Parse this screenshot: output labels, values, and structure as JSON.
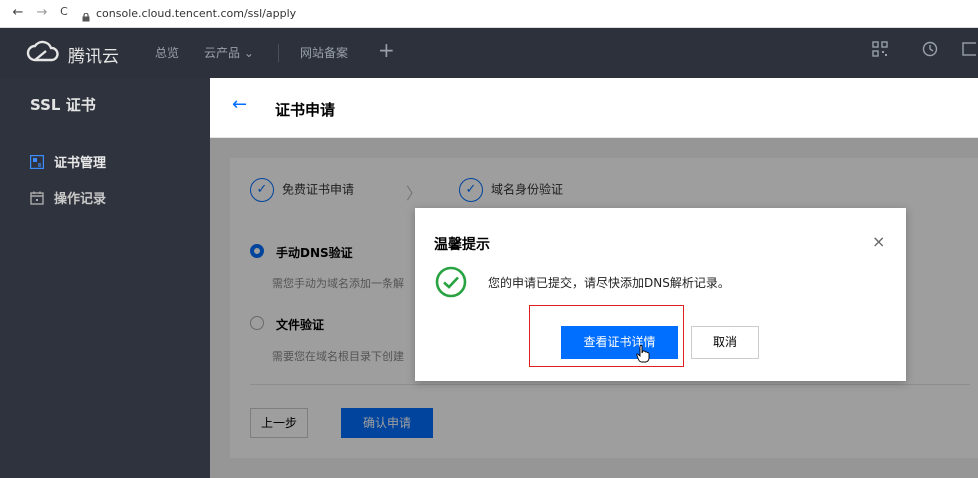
{
  "browser": {
    "back": "←",
    "forward": "→",
    "reload": "C",
    "url": "console.cloud.tencent.com/ssl/apply"
  },
  "topnav": {
    "brand": "腾讯云",
    "items": [
      "总览",
      "云产品 ⌄",
      "网站备案"
    ],
    "plus": "+",
    "right_icons": [
      "qrcode-icon",
      "clock-icon",
      "message-icon"
    ]
  },
  "sidebar": {
    "title": "SSL 证书",
    "items": [
      {
        "label": "证书管理",
        "icon": "cert-icon"
      },
      {
        "label": "操作记录",
        "icon": "calendar-icon"
      }
    ]
  },
  "page": {
    "back_icon": "←",
    "title": "证书申请"
  },
  "steps": [
    {
      "label": "免费证书申请",
      "icon": "check-circle-icon"
    },
    {
      "label": "域名身份验证",
      "icon": "check-circle-icon"
    }
  ],
  "step_separator": "〉",
  "options": [
    {
      "label": "手动DNS验证",
      "desc": "需您手动为域名添加一条解",
      "selected": true
    },
    {
      "label": "文件验证",
      "desc": "需要您在域名根目录下创建",
      "selected": false
    }
  ],
  "buttons": {
    "prev": "上一步",
    "confirm": "确认申请"
  },
  "dialog": {
    "title": "温馨提示",
    "close": "×",
    "message": "您的申请已提交，请尽快添加DNS解析记录。",
    "primary": "查看证书详情",
    "cancel": "取消"
  },
  "colors": {
    "accent": "#006eff",
    "topnav_bg": "#2c313b",
    "sidebar_bg": "#2e333d",
    "success": "#29a341",
    "highlight": "#e02020"
  }
}
